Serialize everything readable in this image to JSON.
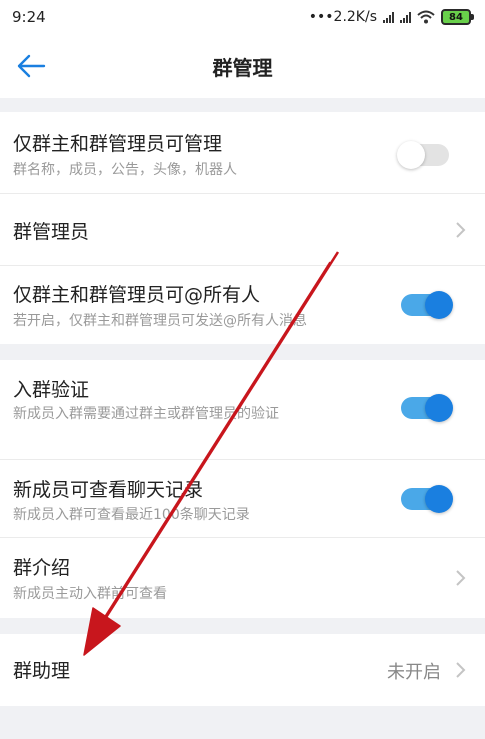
{
  "status_bar": {
    "time": "9:24",
    "network_speed": "•••2.2K/s",
    "battery": "84",
    "icons": [
      "signal-icon",
      "signal-icon",
      "wifi-icon",
      "battery-icon"
    ]
  },
  "header": {
    "title": "群管理",
    "back_icon": "arrow-left-icon"
  },
  "settings": {
    "owner_admin_manage": {
      "title": "仅群主和群管理员可管理",
      "subtitle": "群名称，成员，公告，头像，机器人",
      "enabled": false
    },
    "admins": {
      "title": "群管理员"
    },
    "at_all": {
      "title": "仅群主和群管理员可@所有人",
      "subtitle": "若开启，仅群主和群管理员可发送@所有人消息",
      "enabled": true
    },
    "join_verify": {
      "title": "入群验证",
      "subtitle": "新成员入群需要通过群主或群管理员的验证",
      "enabled": true
    },
    "history_visible": {
      "title": "新成员可查看聊天记录",
      "subtitle": "新成员入群可查看最近100条聊天记录",
      "enabled": true
    },
    "intro": {
      "title": "群介绍",
      "subtitle": "新成员主动入群前可查看"
    },
    "assistant": {
      "title": "群助理",
      "value": "未开启"
    }
  },
  "colors": {
    "accent": "#1a7fe0",
    "toggle_track_on": "#4aa8e8",
    "annotation": "#c8161d"
  }
}
